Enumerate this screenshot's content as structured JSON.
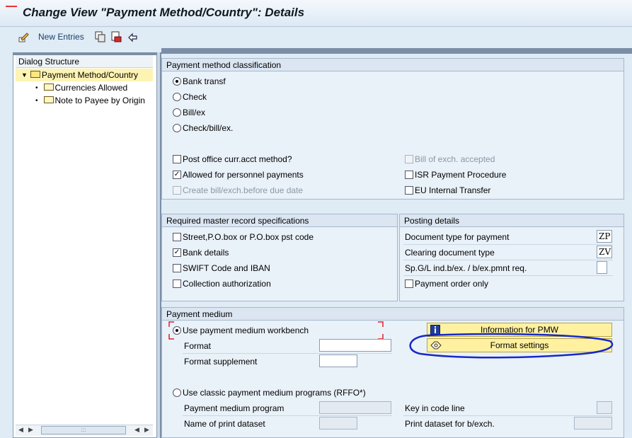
{
  "window": {
    "title": "Change View \"Payment Method/Country\": Details"
  },
  "toolbar": {
    "new_entries": "New Entries",
    "icons": [
      "edit-pencil-icon",
      "copy-icon",
      "delete-icon",
      "undo-icon"
    ]
  },
  "dialog_structure": {
    "header": "Dialog Structure",
    "items": [
      {
        "label": "Payment Method/Country",
        "selected": true,
        "expanded": true
      },
      {
        "label": "Currencies Allowed",
        "selected": false
      },
      {
        "label": "Note to Payee by Origin",
        "selected": false
      }
    ]
  },
  "classification": {
    "title": "Payment method classification",
    "radios": [
      {
        "label": "Bank transf",
        "selected": true
      },
      {
        "label": "Check",
        "selected": false
      },
      {
        "label": "Bill/ex",
        "selected": false
      },
      {
        "label": "Check/bill/ex.",
        "selected": false
      }
    ],
    "left_checks": [
      {
        "label": "Post office curr.acct method?",
        "checked": false,
        "enabled": true
      },
      {
        "label": "Allowed for personnel payments",
        "checked": true,
        "enabled": true
      },
      {
        "label": "Create bill/exch.before due date",
        "checked": false,
        "enabled": false
      }
    ],
    "right_checks": [
      {
        "label": "Bill of exch. accepted",
        "checked": false,
        "enabled": false
      },
      {
        "label": "ISR Payment Procedure",
        "checked": false,
        "enabled": true
      },
      {
        "label": "EU Internal Transfer",
        "checked": false,
        "enabled": true
      }
    ]
  },
  "master_record": {
    "title": "Required master record specifications",
    "checks": [
      {
        "label": "Street,P.O.box or P.O.box pst code",
        "checked": false
      },
      {
        "label": "Bank details",
        "checked": true
      },
      {
        "label": "SWIFT Code and IBAN",
        "checked": false
      },
      {
        "label": "Collection authorization",
        "checked": false
      }
    ]
  },
  "posting": {
    "title": "Posting details",
    "doc_type_label": "Document type for payment",
    "doc_type_value": "ZP",
    "clearing_label": "Clearing document type",
    "clearing_value": "ZV",
    "spgl_label": "Sp.G/L ind.b/ex. / b/ex.pmnt req.",
    "spgl_value": "",
    "payment_order_label": "Payment order only",
    "payment_order_checked": false
  },
  "medium": {
    "title": "Payment medium",
    "pmw_label": "Use payment medium workbench",
    "pmw_selected": true,
    "format_label": "Format",
    "format_value": "",
    "format_supplement_label": "Format supplement",
    "format_supplement_value": "",
    "info_button": "Information for PMW",
    "format_settings_button": "Format settings",
    "classic_label": "Use classic payment medium programs (RFFO*)",
    "classic_selected": false,
    "program_label": "Payment medium program",
    "print_dataset_label": "Name of print dataset",
    "key_code_label": "Key in code line",
    "print_bexch_label": "Print dataset for b/exch."
  },
  "colors": {
    "background": "#dfebf5",
    "button_yellow": "#fff1a0",
    "annotation_blue": "#1628c8",
    "selected_tree": "#fdf3b3"
  }
}
